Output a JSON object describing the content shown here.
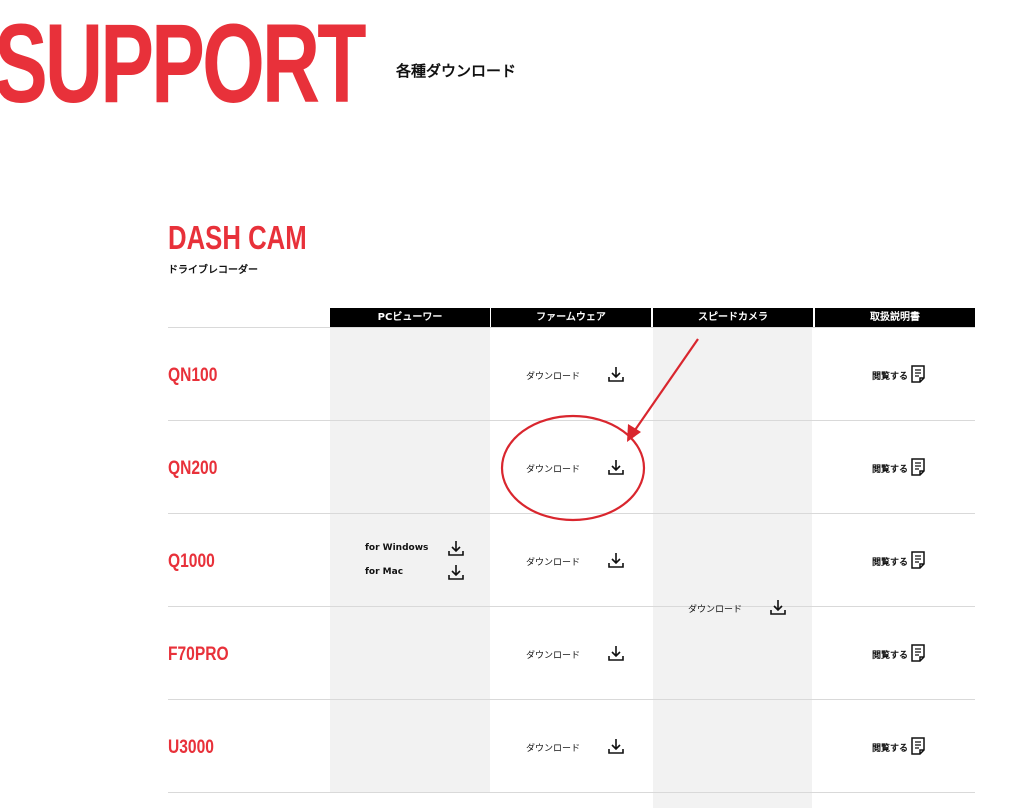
{
  "header": {
    "title": "SUPPORT",
    "subtitle": "各種ダウンロード"
  },
  "section": {
    "title": "DASH CAM",
    "subtitle": "ドライブレコーダー"
  },
  "table": {
    "columns": [
      "PCビューワー",
      "ファームウェア",
      "スピードカメラ",
      "取扱説明書"
    ],
    "models": [
      "QN100",
      "QN200",
      "Q1000",
      "F70PRO",
      "U3000"
    ],
    "firmware_label": "ダウンロード",
    "manual_label": "閲覧する",
    "pc_viewer": {
      "windows": "for Windows",
      "mac": "for Mac"
    },
    "speed_camera_label": "ダウンロード"
  },
  "colors": {
    "accent": "#e8313a",
    "header_bg": "#000000",
    "cell_gray": "#f2f2f2"
  },
  "icons": {
    "download": "download-icon",
    "manual": "document-icon"
  }
}
